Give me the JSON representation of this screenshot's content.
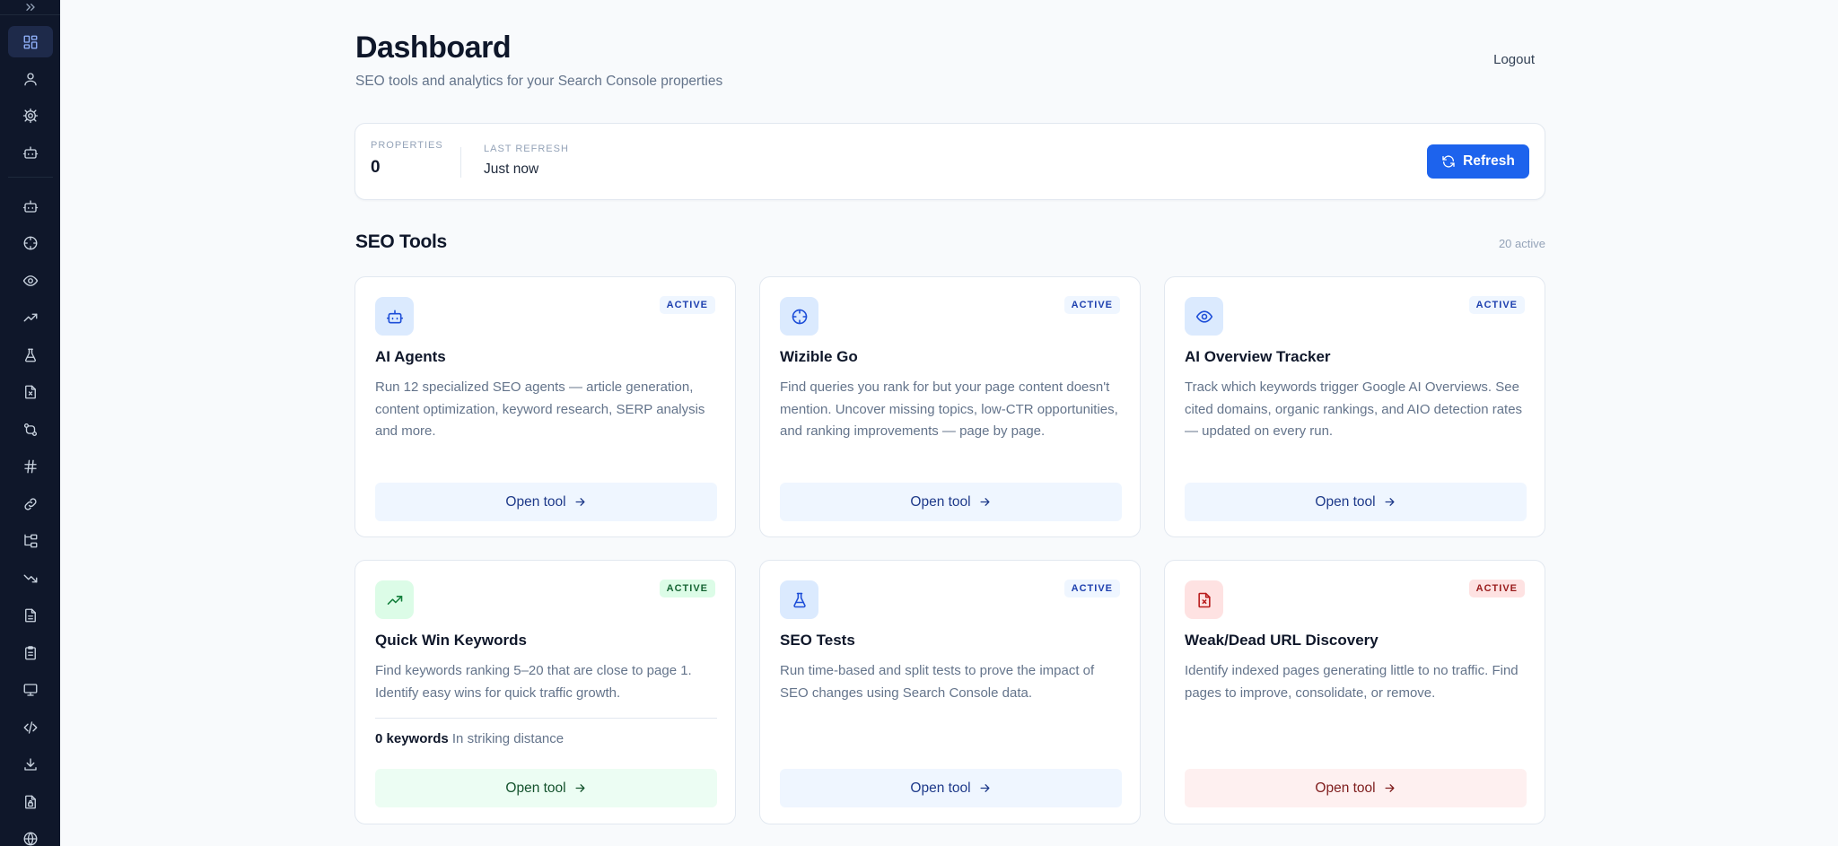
{
  "header": {
    "title": "Dashboard",
    "subtitle": "SEO tools and analytics for your Search Console properties",
    "logout_label": "Logout"
  },
  "stats": {
    "properties_label": "PROPERTIES",
    "properties_value": "0",
    "last_refresh_label": "LAST REFRESH",
    "last_refresh_value": "Just now",
    "refresh_label": "Refresh"
  },
  "tools_section": {
    "title": "SEO Tools",
    "count": "20 active"
  },
  "sidebar": {
    "icons": [
      "chevrons-right-icon",
      "dashboard-icon",
      "user-icon",
      "settings-icon",
      "bot-icon",
      "bot-icon",
      "crosshair-icon",
      "eye-icon",
      "trending-up-icon",
      "flask-icon",
      "file-x-icon",
      "git-compare-icon",
      "hash-icon",
      "link-icon",
      "folder-tree-icon",
      "trending-down-icon",
      "file-text-icon",
      "clipboard-icon",
      "monitor-icon",
      "code-icon",
      "download-icon",
      "file-lock-icon",
      "globe-icon"
    ]
  },
  "cards": [
    {
      "title": "AI Agents",
      "badge": "ACTIVE",
      "description": "Run 12 specialized SEO agents — article generation, content optimization, keyword research, SERP analysis and more.",
      "button": "Open tool",
      "icon": "bot-icon",
      "theme": "blue"
    },
    {
      "title": "Wizible Go",
      "badge": "ACTIVE",
      "description": "Find queries you rank for but your page content doesn't mention. Uncover missing topics, low-CTR opportunities, and ranking improvements — page by page.",
      "button": "Open tool",
      "icon": "crosshair-icon",
      "theme": "blue"
    },
    {
      "title": "AI Overview Tracker",
      "badge": "ACTIVE",
      "description": "Track which keywords trigger Google AI Overviews. See cited domains, organic rankings, and AIO detection rates — updated on every run.",
      "button": "Open tool",
      "icon": "eye-icon",
      "theme": "blue"
    },
    {
      "title": "Quick Win Keywords",
      "badge": "ACTIVE",
      "description": "Find keywords ranking 5–20 that are close to page 1. Identify easy wins for quick traffic growth.",
      "metric_value": "0 keywords",
      "metric_label": "In striking distance",
      "button": "Open tool",
      "icon": "trending-up-icon",
      "theme": "green"
    },
    {
      "title": "SEO Tests",
      "badge": "ACTIVE",
      "description": "Run time-based and split tests to prove the impact of SEO changes using Search Console data.",
      "button": "Open tool",
      "icon": "flask-icon",
      "theme": "blue"
    },
    {
      "title": "Weak/Dead URL Discovery",
      "badge": "ACTIVE",
      "description": "Identify indexed pages generating little to no traffic. Find pages to improve, consolidate, or remove.",
      "button": "Open tool",
      "icon": "file-x-icon",
      "theme": "red"
    }
  ]
}
